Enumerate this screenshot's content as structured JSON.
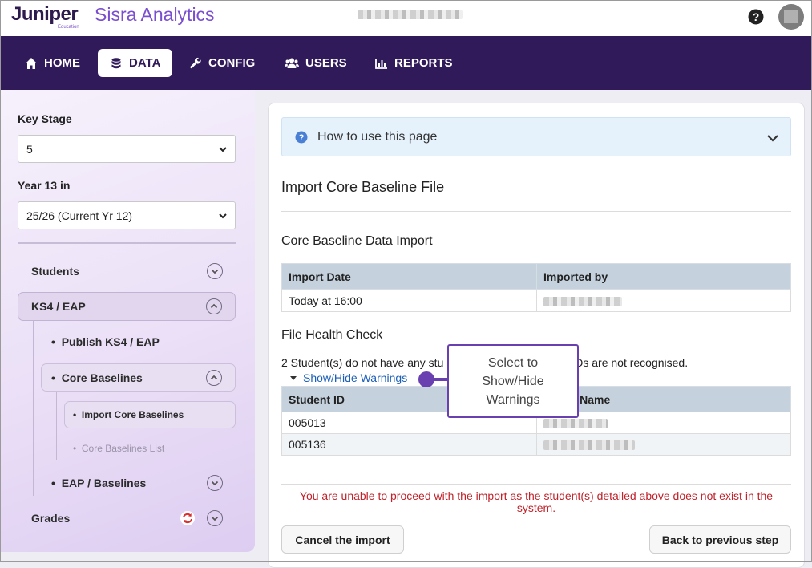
{
  "header": {
    "brand": "Juniper",
    "brand_sub": "Education",
    "product": "Sisra Analytics",
    "help_icon": "question-circle-icon",
    "avatar_icon": "user-avatar"
  },
  "nav": {
    "items": [
      {
        "label": "HOME",
        "icon": "home-icon"
      },
      {
        "label": "DATA",
        "icon": "database-icon",
        "active": true
      },
      {
        "label": "CONFIG",
        "icon": "wrench-icon"
      },
      {
        "label": "USERS",
        "icon": "users-icon"
      },
      {
        "label": "REPORTS",
        "icon": "bar-chart-icon"
      }
    ]
  },
  "sidebar": {
    "key_stage_label": "Key Stage",
    "key_stage_value": "5",
    "year_label": "Year 13 in",
    "year_value": "25/26 (Current Yr 12)",
    "items": {
      "students": "Students",
      "ks4": "KS4 / EAP",
      "publish": "Publish KS4 / EAP",
      "core_baselines": "Core Baselines",
      "import_core": "Import Core Baselines",
      "core_list": "Core Baselines List",
      "eap_baselines": "EAP / Baselines",
      "grades": "Grades"
    }
  },
  "main": {
    "how_to": "How to use this page",
    "title": "Import Core Baseline File",
    "import_section": "Core Baseline Data Import",
    "import_table": {
      "headers": [
        "Import Date",
        "Imported by"
      ],
      "rows": [
        [
          "Today at 16:00",
          ""
        ]
      ]
    },
    "health_title": "File Health Check",
    "health_text_a": "2 Student(s) do not have any stu",
    "health_text_b": "IDs are not recognised.",
    "toggle_label": "Show/Hide Warnings",
    "warn_table": {
      "headers": [
        "Student ID",
        "nt Name"
      ],
      "rows": [
        [
          "005013",
          ""
        ],
        [
          "005136",
          ""
        ]
      ]
    },
    "error": "You are unable to proceed with the import as the student(s) detailed above does not exist in the system.",
    "cancel_button": "Cancel the import",
    "back_button": "Back to previous step"
  },
  "callout": {
    "text_line1": "Select to",
    "text_line2": "Show/Hide",
    "text_line3": "Warnings"
  },
  "colors": {
    "nav_bg": "#311a59",
    "accent": "#6a3fb0",
    "brand": "#7a4fcf",
    "error": "#c0232b",
    "link": "#1c5fb8"
  }
}
